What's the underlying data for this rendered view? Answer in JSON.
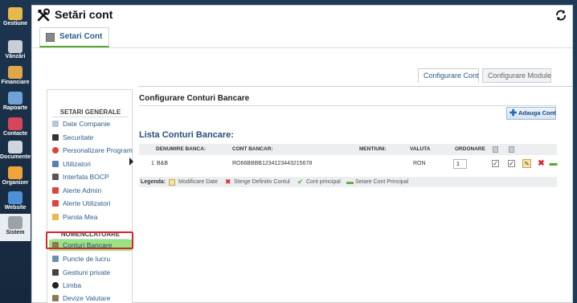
{
  "sidebar": {
    "items": [
      {
        "label": "Gestiune",
        "color": "#e8b84a"
      },
      {
        "label": "Vânzări",
        "color": "#c7d0d9"
      },
      {
        "label": "Financiare",
        "color": "#e0a74a"
      },
      {
        "label": "Rapoarte",
        "color": "#6fa3d6"
      },
      {
        "label": "Contacte",
        "color": "#d6455a"
      },
      {
        "label": "Documente",
        "color": "#cfd6dd"
      },
      {
        "label": "Organizer",
        "color": "#f0a43a"
      },
      {
        "label": "Website",
        "color": "#4f8fd6"
      },
      {
        "label": "Sistem",
        "color": "#9aa3ab"
      }
    ],
    "active_index": 8
  },
  "header": {
    "title": "Setări cont",
    "tab": "Setari Cont"
  },
  "subtabs": [
    "Configurare Cont",
    "Configurare Module"
  ],
  "menu": {
    "general_title": "SETARI GENERALE",
    "general_items": [
      {
        "label": "Date Companie",
        "color": "#b8c8d8"
      },
      {
        "label": "Securitate",
        "color": "#333333"
      },
      {
        "label": "Personalizare Program",
        "color": "#d9463b"
      },
      {
        "label": "Utilizatori",
        "color": "#5b7fb0"
      },
      {
        "label": "Interfata BOCP",
        "color": "#555555"
      },
      {
        "label": "Alerte Admin",
        "color": "#d9463b"
      },
      {
        "label": "Alerte Utilizatori",
        "color": "#d9463b"
      },
      {
        "label": "Parola Mea",
        "color": "#e8b84a"
      }
    ],
    "nomen_title": "NOMENCLATOARE",
    "nomen_items": [
      {
        "label": "Conturi Bancare",
        "color": "#8a7a55"
      },
      {
        "label": "Puncte de lucru",
        "color": "#6f8fb0"
      },
      {
        "label": "Gestiuni private",
        "color": "#444444"
      },
      {
        "label": "Limba",
        "color": "#222222"
      },
      {
        "label": "Devize Valutare",
        "color": "#8a7a55"
      }
    ],
    "selected": "Conturi Bancare"
  },
  "content": {
    "section_title": "Configurare Conturi Bancare",
    "add_button": "Adauga Cont",
    "list_title": "Lista Conturi Bancare:",
    "columns": [
      "DENUMIRE BANCA:",
      "CONT BANCAR:",
      "MENTIUNI:",
      "VALUTA",
      "ORDONARE"
    ],
    "rows": [
      {
        "index": "1",
        "bank": "B&B",
        "account": "RO66BBBB1234123443215678",
        "mentions": "",
        "currency": "RON",
        "order": "1",
        "check1": true,
        "check2": true
      }
    ],
    "legend": {
      "label": "Legenda:",
      "items": [
        "Modificare Date",
        "Sterge Definitiv Contul",
        "Cont principal",
        "Setare Cont Principal"
      ]
    }
  },
  "colors": {
    "accent": "#2a5a8a",
    "selected_bg": "#9be486",
    "highlight": "#d9232d",
    "delete": "#d9232d",
    "confirm": "#5aa832"
  }
}
